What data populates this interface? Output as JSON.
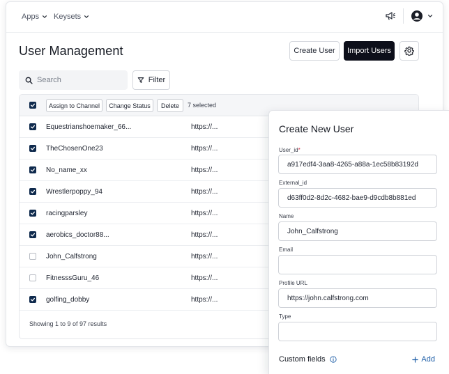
{
  "nav": {
    "apps_label": "Apps",
    "keysets_label": "Keysets"
  },
  "page": {
    "title": "User Management"
  },
  "actions": {
    "create_user": "Create User",
    "import_users": "Import Users"
  },
  "search": {
    "placeholder": "Search"
  },
  "filter": {
    "label": "Filter"
  },
  "bulk": {
    "assign_to_channel": "Assign to Channel",
    "change_status": "Change Status",
    "delete": "Delete",
    "selected_count": "7 selected"
  },
  "rows": [
    {
      "name": "Equestrianshoemaker_66...",
      "url": "https://...",
      "checked": true
    },
    {
      "name": "TheChosenOne23",
      "url": "https://...",
      "checked": true
    },
    {
      "name": "No_name_xx",
      "url": "https://...",
      "checked": true
    },
    {
      "name": "Wrestlerpoppy_94",
      "url": "https://...",
      "checked": true
    },
    {
      "name": "racingparsley",
      "url": "https://...",
      "checked": true
    },
    {
      "name": "aerobics_doctor88...",
      "url": "https://...",
      "checked": true
    },
    {
      "name": "John_Calfstrong",
      "url": "https://...",
      "checked": false
    },
    {
      "name": "FitnesssGuru_46",
      "url": "https://...",
      "checked": false
    },
    {
      "name": "golfing_dobby",
      "url": "https://...",
      "checked": true
    }
  ],
  "footer": {
    "results": "Showing 1 to 9 of 97 results"
  },
  "panel": {
    "title": "Create New User",
    "user_id_label": "User_id",
    "required_mark": "*",
    "user_id_value": "a917edf4-3aa8-4265-a88a-1ec58b83192d",
    "external_id_label": "External_id",
    "external_id_value": "d63ff0d2-8d2c-4682-bae9-d9cdb8b881ed",
    "name_label": "Name",
    "name_value": "John_Calfstrong",
    "email_label": "Email",
    "email_value": "",
    "profile_url_label": "Profile URL",
    "profile_url_value": "https://john.calfstrong.com",
    "type_label": "Type",
    "type_value": "",
    "custom_fields_label": "Custom fields",
    "add_label": "Add"
  },
  "colors": {
    "primary_button": "#0d0f1a",
    "checkbox_checked": "#0f2a4d",
    "link": "#1f5fa8",
    "required": "#d12f45"
  }
}
